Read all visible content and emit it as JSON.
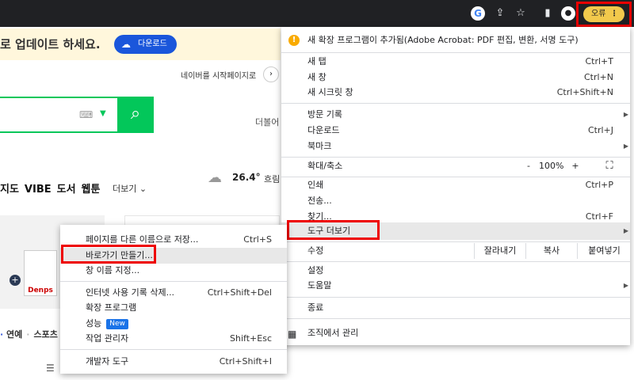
{
  "toolbar": {
    "google_icon": "G",
    "share_icon": "⇪",
    "star_icon": "☆",
    "sidepanel_icon": "▮",
    "profile_icon": "●",
    "error_label": "오류",
    "menu_dots": "⋮"
  },
  "page": {
    "banner_text": "로 업데이트 하세요.",
    "download_label": "다운로드",
    "startpage_text": "네이버를 시작페이지로",
    "startpage_arrow": "›",
    "search_icon": "⌕",
    "more_text": "더볼어",
    "nav_items": [
      "지도",
      "VIBE",
      "도서",
      "웹툰"
    ],
    "nav_more": "더보기 ⌄",
    "weather_temp": "26.4°",
    "weather_label": "흐림",
    "ad_bag_text": "Denps",
    "news_tabs": [
      "연예",
      "스포츠"
    ],
    "news_tab_prefix": "·"
  },
  "chrome_menu": {
    "notice": "새 확장 프로그램이 추가됨(Adobe Acrobat: PDF 편집, 변환, 서명 도구)",
    "items": [
      {
        "label": "새 탭",
        "shortcut": "Ctrl+T"
      },
      {
        "label": "새 창",
        "shortcut": "Ctrl+N"
      },
      {
        "label": "새 시크릿 창",
        "shortcut": "Ctrl+Shift+N"
      },
      {
        "label": "방문 기록",
        "shortcut": "▶"
      },
      {
        "label": "다운로드",
        "shortcut": "Ctrl+J"
      },
      {
        "label": "북마크",
        "shortcut": "▶"
      }
    ],
    "zoom": {
      "label": "확대/축소",
      "minus": "-",
      "value": "100%",
      "plus": "+",
      "fullscreen": "⛶"
    },
    "print": {
      "label": "인쇄",
      "shortcut": "Ctrl+P"
    },
    "cast": {
      "label": "전송..."
    },
    "find": {
      "label": "찾기...",
      "shortcut": "Ctrl+F"
    },
    "more_tools": {
      "label": "도구 더보기",
      "chevron": "▶"
    },
    "edit": {
      "label": "수정",
      "cut": "잘라내기",
      "copy": "복사",
      "paste": "붙여넣기"
    },
    "settings": {
      "label": "설정"
    },
    "help": {
      "label": "도움말",
      "chevron": "▶"
    },
    "exit": {
      "label": "종료"
    },
    "managed": {
      "label": "조직에서 관리",
      "icon": "▦"
    }
  },
  "sub_menu": {
    "items": [
      {
        "label": "페이지를 다른 이름으로 저장...",
        "shortcut": "Ctrl+S"
      },
      {
        "label": "바로가기 만들기...",
        "shortcut": ""
      },
      {
        "label": "창 이름 지정...",
        "shortcut": ""
      },
      {
        "label": "인터넷 사용 기록 삭제...",
        "shortcut": "Ctrl+Shift+Del"
      },
      {
        "label": "확장 프로그램",
        "shortcut": ""
      },
      {
        "label": "성능",
        "shortcut": "",
        "badge": "New"
      },
      {
        "label": "작업 관리자",
        "shortcut": "Shift+Esc"
      },
      {
        "label": "개발자 도구",
        "shortcut": "Ctrl+Shift+I"
      }
    ]
  },
  "colors": {
    "accent_green": "#03c75a",
    "highlight_red": "#ee0000",
    "error_yellow": "#f2c94c",
    "badge_blue": "#1a73e8"
  }
}
